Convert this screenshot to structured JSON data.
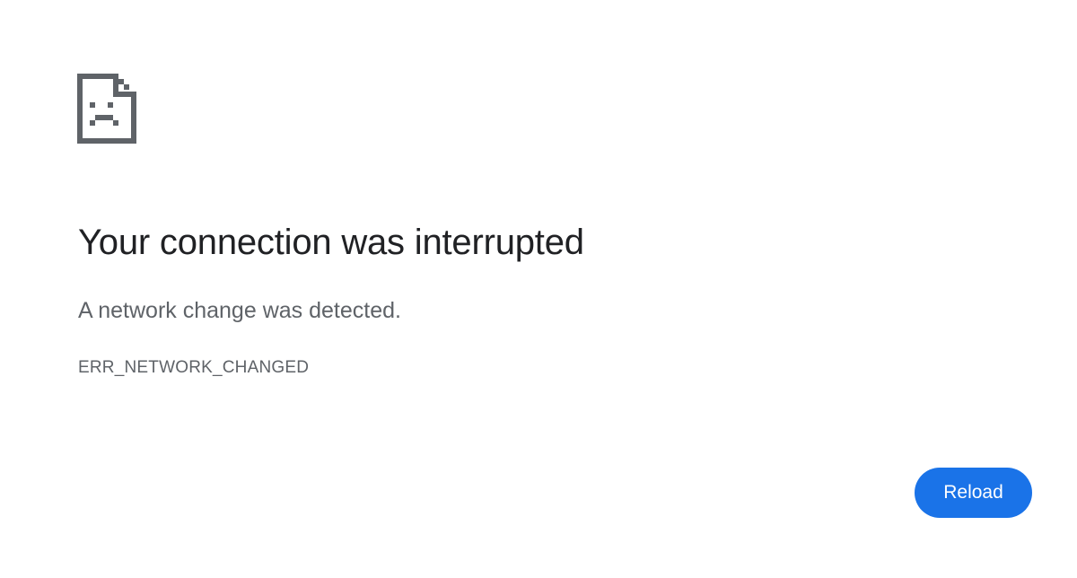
{
  "error": {
    "icon": "sad-page-icon",
    "title": "Your connection was interrupted",
    "description": "A network change was detected.",
    "code": "ERR_NETWORK_CHANGED"
  },
  "actions": {
    "reload_label": "Reload"
  },
  "colors": {
    "title": "#202124",
    "secondary_text": "#5f6368",
    "icon": "#5f6368",
    "button_bg": "#1a73e8",
    "button_text": "#ffffff",
    "background": "#ffffff"
  }
}
